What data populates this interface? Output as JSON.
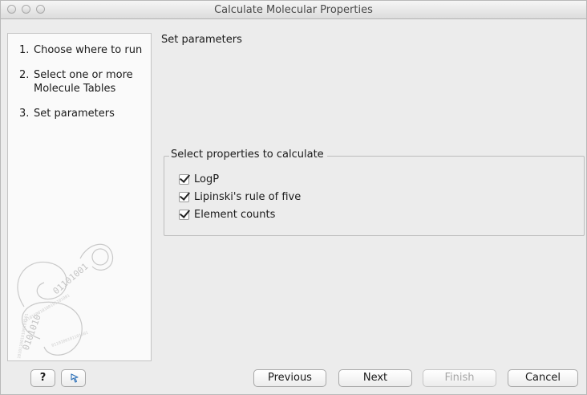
{
  "window": {
    "title": "Calculate Molecular Properties"
  },
  "sidebar": {
    "steps": [
      {
        "num": "1.",
        "line1": "Choose where to run",
        "line2": ""
      },
      {
        "num": "2.",
        "line1": "Select one or more",
        "line2": "Molecule Tables"
      },
      {
        "num": "3.",
        "line1": "Set parameters",
        "line2": ""
      }
    ],
    "decoration": "swirl-binary-logo"
  },
  "main": {
    "title": "Set parameters",
    "group": {
      "legend": "Select properties to calculate",
      "options": [
        {
          "label": "LogP",
          "checked": true
        },
        {
          "label": "Lipinski's rule of five",
          "checked": true
        },
        {
          "label": "Element counts",
          "checked": true
        }
      ]
    }
  },
  "footer": {
    "help_label": "?",
    "reset_icon": "reset-icon",
    "previous_label": "Previous",
    "next_label": "Next",
    "finish_label": "Finish",
    "cancel_label": "Cancel"
  }
}
